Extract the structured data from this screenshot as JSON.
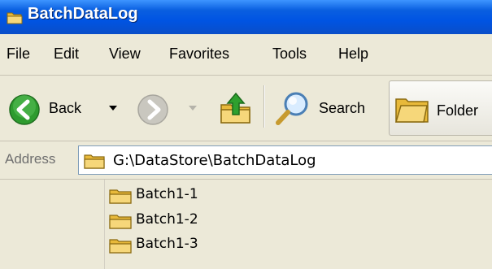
{
  "window": {
    "title": "BatchDataLog"
  },
  "menu": {
    "items": [
      "File",
      "Edit",
      "View",
      "Favorites",
      "Tools",
      "Help"
    ]
  },
  "toolbar": {
    "back_label": "Back",
    "search_label": "Search",
    "folders_label": "Folder",
    "icons": [
      "back-arrow-icon",
      "dropdown-arrow-icon",
      "forward-arrow-icon",
      "up-folder-icon",
      "search-magnifier-icon",
      "folders-icon"
    ]
  },
  "address": {
    "label": "Address",
    "value": "G:\\DataStore\\BatchDataLog"
  },
  "folders": [
    {
      "name": "Batch1-1"
    },
    {
      "name": "Batch1-2"
    },
    {
      "name": "Batch1-3"
    }
  ],
  "colors": {
    "titlebar": "#0054e3",
    "back_green": "#2e9b2e",
    "folder_yellow": "#e8b93a"
  }
}
